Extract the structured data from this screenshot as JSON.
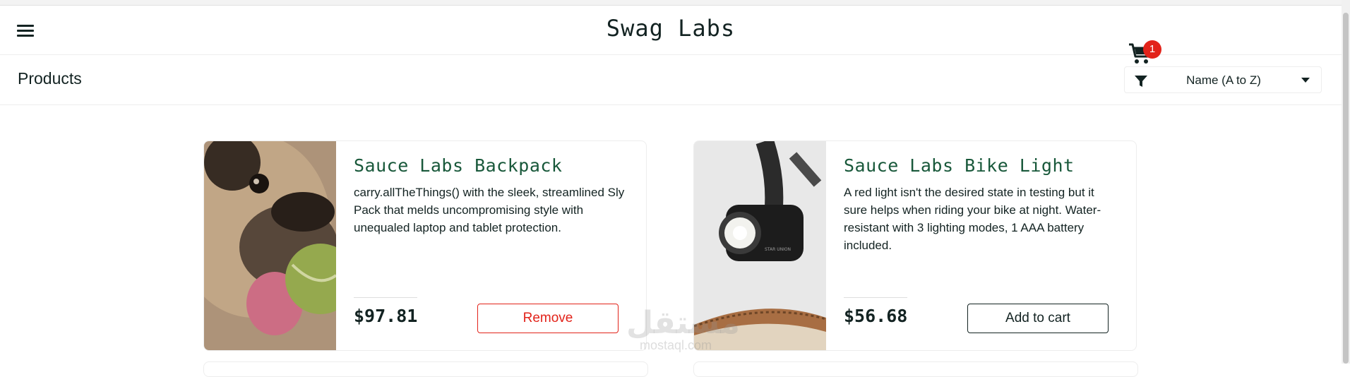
{
  "header": {
    "menu_icon": "hamburger-menu-icon",
    "logo": "Swag Labs",
    "cart_icon": "shopping-cart-icon",
    "cart_badge_count": "1"
  },
  "secondary_header": {
    "title": "Products",
    "sort": {
      "filter_icon": "filter-icon",
      "selected": "Name (A to Z)",
      "caret_icon": "caret-down-icon"
    }
  },
  "inventory": [
    {
      "name": "Sauce Labs Backpack",
      "description": "carry.allTheThings() with the sleek, streamlined Sly Pack that melds uncompromising style with unequaled laptop and tablet protection.",
      "price": "$97.81",
      "button_label": "Remove",
      "image_subject": "pug holding a tennis ball"
    },
    {
      "name": "Sauce Labs Bike Light",
      "description": "A red light isn't the desired state in testing but it sure helps when riding your bike at night. Water-resistant with 3 lighting modes, 1 AAA battery included.",
      "price": "$56.68",
      "button_label": "Add to cart",
      "image_subject": "bike headlight mounted on a bicycle",
      "image_text": "STAR UNION"
    }
  ],
  "watermark": {
    "arabic": "مستقل",
    "latin": "mostaql.com"
  },
  "colors": {
    "brand_text": "#132322",
    "item_name": "#18583a",
    "badge_red": "#e2231a",
    "remove_red": "#e2231a",
    "border": "#ededed"
  }
}
